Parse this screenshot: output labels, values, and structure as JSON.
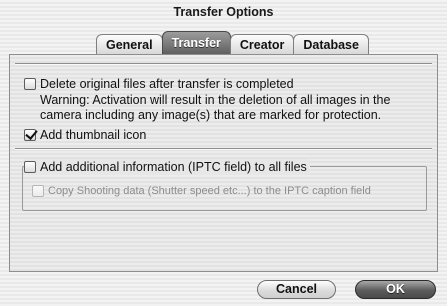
{
  "window": {
    "title": "Transfer Options"
  },
  "tabs": [
    {
      "label": "General",
      "active": false
    },
    {
      "label": "Transfer",
      "active": true
    },
    {
      "label": "Creator",
      "active": false
    },
    {
      "label": "Database",
      "active": false
    }
  ],
  "options": {
    "delete_original": {
      "label": "Delete original files after transfer is completed",
      "checked": false,
      "warning_line1": "Warning: Activation will result in the deletion of all images in the",
      "warning_line2": "camera including any image(s) that are marked for protection."
    },
    "add_thumbnail": {
      "label": "Add thumbnail icon",
      "checked": true
    },
    "add_iptc": {
      "label": "Add additional information (IPTC field) to all files",
      "checked": false
    },
    "copy_shooting_data": {
      "label": "Copy Shooting data (Shutter speed etc...)  to the IPTC caption field",
      "checked": false,
      "enabled": false
    }
  },
  "buttons": {
    "cancel": "Cancel",
    "ok": "OK"
  }
}
